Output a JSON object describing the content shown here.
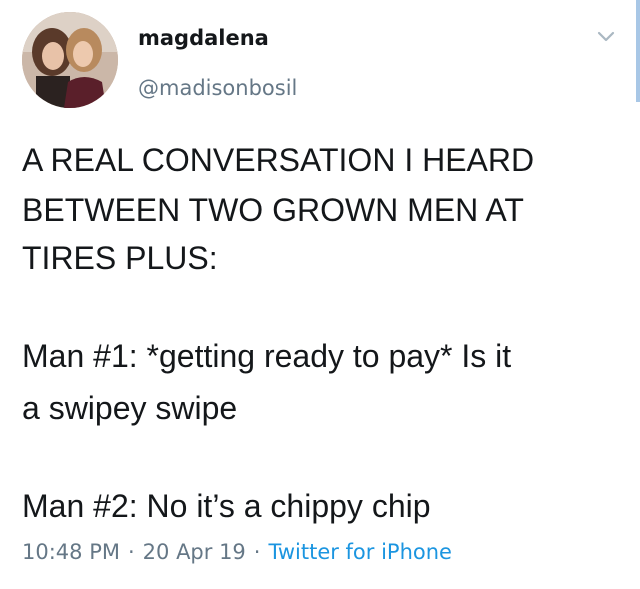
{
  "user": {
    "display_name": "magdalena",
    "handle": "@madisonbosil",
    "avatar_icon": "profile-photo"
  },
  "tweet": {
    "lines": [
      "A REAL CONVERSATION I HEARD",
      "BETWEEN TWO GROWN MEN AT",
      "TIRES PLUS:",
      "Man #1: *getting ready to pay* Is it",
      "a swipey swipe",
      "Man #2: No it’s a chippy chip"
    ],
    "time": "10:48 PM",
    "date": "20 Apr 19",
    "separator": "·",
    "source": "Twitter for iPhone"
  },
  "icons": {
    "menu": "chevron-down-icon"
  },
  "colors": {
    "text": "#14171a",
    "muted": "#657786",
    "link": "#1b95e0"
  }
}
